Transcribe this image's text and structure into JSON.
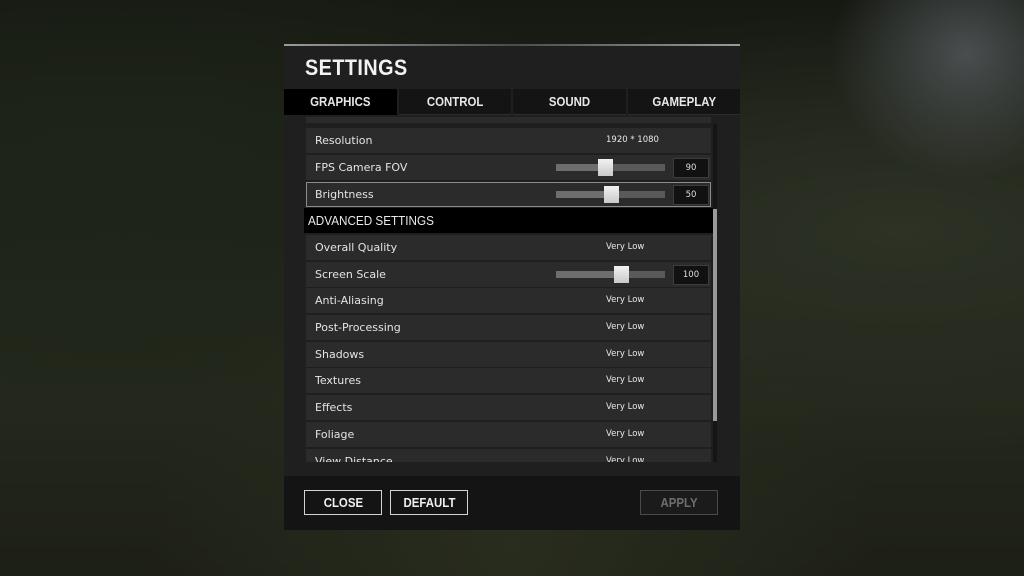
{
  "window": {
    "title": "SETTINGS"
  },
  "tabs": [
    {
      "label": "GRAPHICS",
      "active": true
    },
    {
      "label": "CONTROL",
      "active": false
    },
    {
      "label": "SOUND",
      "active": false
    },
    {
      "label": "GAMEPLAY",
      "active": false
    }
  ],
  "basic_settings": {
    "resolution": {
      "label": "Resolution",
      "value": "1920 * 1080"
    },
    "fov": {
      "label": "FPS Camera FOV",
      "value": "90",
      "level": 0.45
    },
    "brightness": {
      "label": "Brightness",
      "value": "50",
      "level": 0.5
    }
  },
  "advanced": {
    "header": "ADVANCED SETTINGS",
    "overall_quality": {
      "label": "Overall Quality",
      "value": "Very Low"
    },
    "screen_scale": {
      "label": "Screen Scale",
      "value": "100",
      "level": 0.6
    },
    "anti_aliasing": {
      "label": "Anti-Aliasing",
      "value": "Very Low"
    },
    "post_processing": {
      "label": "Post-Processing",
      "value": "Very Low"
    },
    "shadows": {
      "label": "Shadows",
      "value": "Very Low"
    },
    "textures": {
      "label": "Textures",
      "value": "Very Low"
    },
    "effects": {
      "label": "Effects",
      "value": "Very Low"
    },
    "foliage": {
      "label": "Foliage",
      "value": "Very Low"
    },
    "view_distance": {
      "label": "View Distance",
      "value": "Very Low"
    }
  },
  "footer": {
    "close_label": "CLOSE",
    "default_label": "DEFAULT",
    "apply_label": "APPLY"
  },
  "colors": {
    "panel": "#1f1f1f",
    "row": "#2b2b2b",
    "active_tab": "#000000",
    "text": "#e4e4e4"
  }
}
